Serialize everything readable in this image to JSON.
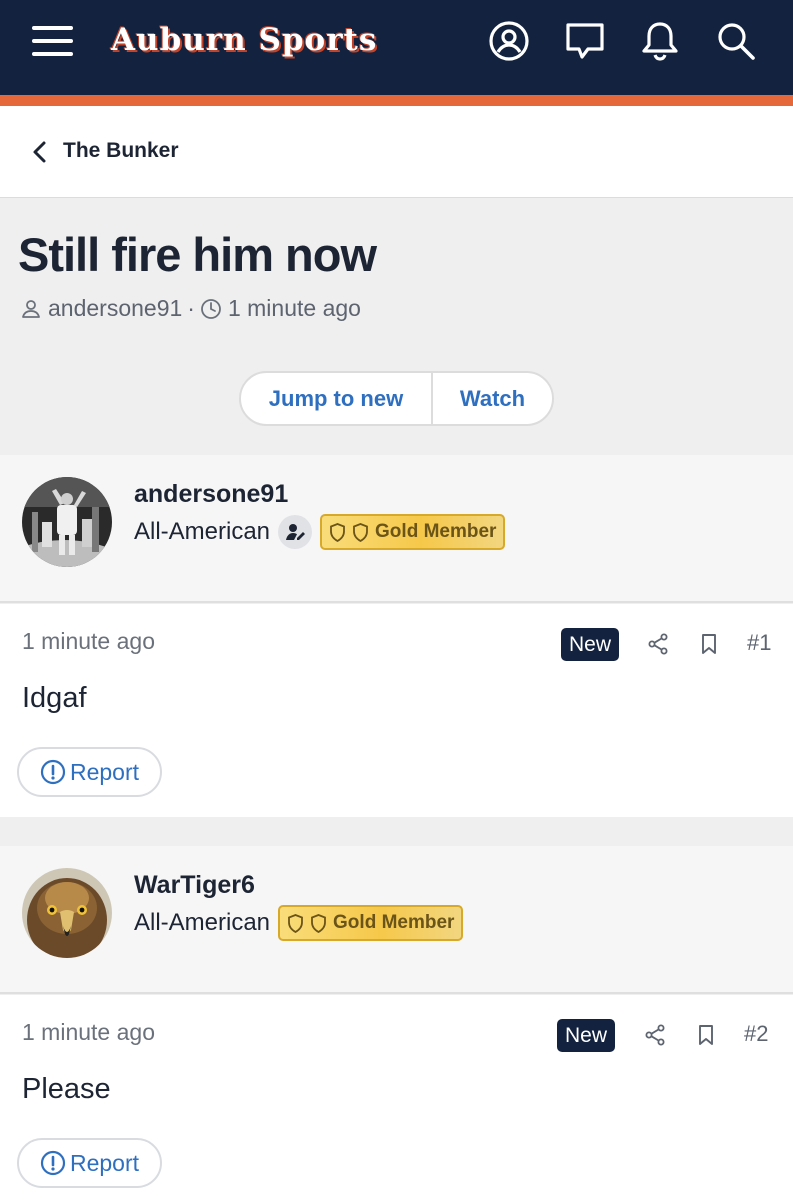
{
  "header": {
    "logo_text": "Auburn Sports",
    "brand_colors": {
      "navy": "#13233f",
      "orange": "#e5683a"
    },
    "icons": [
      "menu-icon",
      "account-icon",
      "chat-icon",
      "bell-icon",
      "search-icon"
    ]
  },
  "breadcrumb": {
    "label": "The Bunker"
  },
  "thread": {
    "title": "Still fire him now",
    "author": "andersone91",
    "separator": "·",
    "time": "1 minute ago",
    "jump_label": "Jump to new",
    "watch_label": "Watch"
  },
  "posts": [
    {
      "username": "andersone91",
      "rank": "All-American",
      "badge": "Gold Member",
      "time": "1 minute ago",
      "new_label": "New",
      "number": "#1",
      "text": "Idgaf",
      "report_label": "Report"
    },
    {
      "username": "WarTiger6",
      "rank": "All-American",
      "badge": "Gold Member",
      "time": "1 minute ago",
      "new_label": "New",
      "number": "#2",
      "text": "Please",
      "report_label": "Report"
    }
  ]
}
